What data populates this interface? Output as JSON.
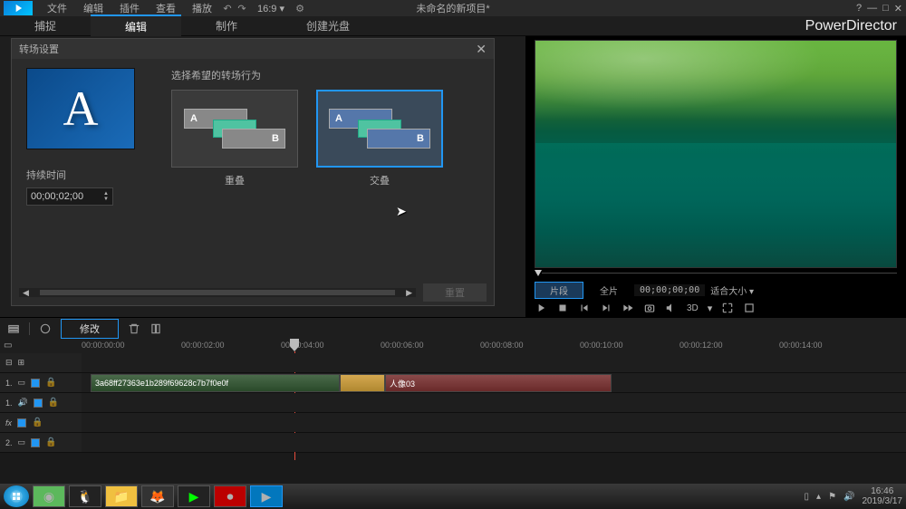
{
  "app": {
    "title": "未命名的新项目*",
    "brand": "PowerDirector"
  },
  "menubar": {
    "items": [
      "文件",
      "编辑",
      "插件",
      "查看",
      "播放"
    ],
    "help": "?",
    "minimize": "—",
    "maximize": "□",
    "close": "✕"
  },
  "tabs": {
    "capture": "捕捉",
    "edit": "编辑",
    "produce": "制作",
    "create_disc": "创建光盘"
  },
  "dialog": {
    "title": "转场设置",
    "preview_letter": "A",
    "duration_label": "持续时间",
    "duration_value": "00;00;02;00",
    "behavior_label": "选择希望的转场行为",
    "opt_a": "A",
    "opt_b": "B",
    "overlap_caption": "重叠",
    "cross_caption": "交叠",
    "reset": "重置"
  },
  "preview": {
    "segment": "片段",
    "full": "全片",
    "timecode": "00;00;00;00",
    "fit": "适合大小",
    "quality": "3D"
  },
  "tl_toolbar": {
    "modify": "修改"
  },
  "timeline": {
    "marks": [
      "00:00:00:00",
      "00:00:02:00",
      "00:00:04:00",
      "00:00:06:00",
      "00:00:08:00",
      "00:00:10:00",
      "00:00:12:00",
      "00:00:14:00"
    ],
    "track1_label": "1.",
    "track2_label": "2.",
    "clip1_name": "3a68ff27363e1b289f69628c7b7f0e0f",
    "clip2_name": "人像03"
  },
  "taskbar": {
    "time": "16:46",
    "date": "2019/3/17"
  }
}
